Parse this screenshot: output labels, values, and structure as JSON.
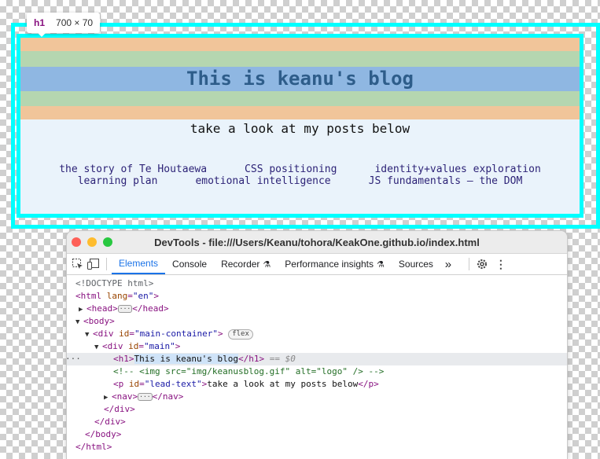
{
  "inspect_tooltip": {
    "tag": "h1",
    "dimensions": "700 × 70"
  },
  "page": {
    "heading": "This is keanu's blog",
    "lead_text": "take a look at my posts below",
    "nav_row_1": [
      "the story of Te Houtaewa",
      "CSS positioning",
      "identity+values exploration"
    ],
    "nav_row_2": [
      "learning plan",
      "emotional intelligence",
      "JS fundamentals – the DOM"
    ],
    "colors": {
      "outline": "#00ffff",
      "band_orange": "#f1c59a",
      "band_green": "#b5d6b0",
      "band_blue": "#8fb7e2",
      "heading": "#2e5d8a",
      "nav_link": "#2d2377",
      "page_bg": "#eaf3fb"
    }
  },
  "devtools": {
    "title": "DevTools - file:///Users/Keanu/tohora/KeakOne.github.io/index.html",
    "tabs": [
      "Elements",
      "Console",
      "Recorder",
      "Performance insights",
      "Sources"
    ],
    "active_tab": "Elements",
    "more_tabs_icon": "chevron-double-right-icon",
    "dom": {
      "doctype": "<!DOCTYPE html>",
      "html_open": "<html",
      "html_lang_attr": "lang",
      "html_lang_val": "\"en\"",
      "head": "<head>",
      "head_close": "</head>",
      "body_open": "<body>",
      "div_open": "<div",
      "id_attr": "id",
      "main_container_val": "\"main-container\"",
      "flex_badge": "flex",
      "main_val": "\"main\"",
      "h1_open": "<h1>",
      "h1_text": "This is keanu's blog",
      "h1_close": "</h1>",
      "selected_marker": "== $0",
      "comment": "<!-- <img src=\"img/keanusblog.gif\" alt=\"logo\" /> -->",
      "p_open": "<p",
      "lead_text_val": "\"lead-text\"",
      "p_text": "take a look at my posts below",
      "p_close": "</p>",
      "nav_open": "<nav>",
      "nav_close": "</nav>",
      "div_close": "</div>",
      "body_close": "</body>",
      "html_close": "</html>",
      "ellipsis": "···",
      "dots": "···"
    }
  }
}
